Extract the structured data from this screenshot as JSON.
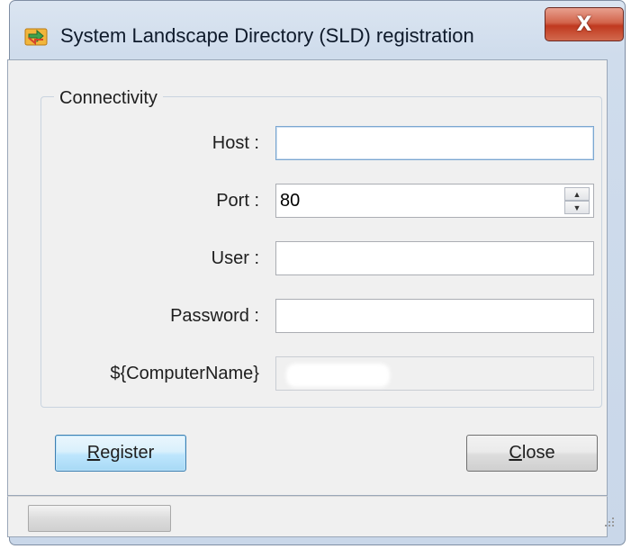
{
  "window": {
    "title": "System Landscape Directory (SLD) registration",
    "close_label": "X"
  },
  "connectivity": {
    "group_label": "Connectivity",
    "host": {
      "label": "Host :",
      "value": ""
    },
    "port": {
      "label": "Port :",
      "value": "80"
    },
    "user": {
      "label": "User :",
      "value": ""
    },
    "password": {
      "label": "Password :",
      "value": ""
    },
    "computer_name": {
      "label": "${ComputerName}",
      "value": ""
    }
  },
  "buttons": {
    "register_label": "Register",
    "close_label": "Close"
  },
  "status": {
    "progress": 0
  },
  "colors": {
    "title_close": "#c0391f",
    "default_button_border": "#3c7fb1",
    "window_frame": "#cfdcec"
  }
}
